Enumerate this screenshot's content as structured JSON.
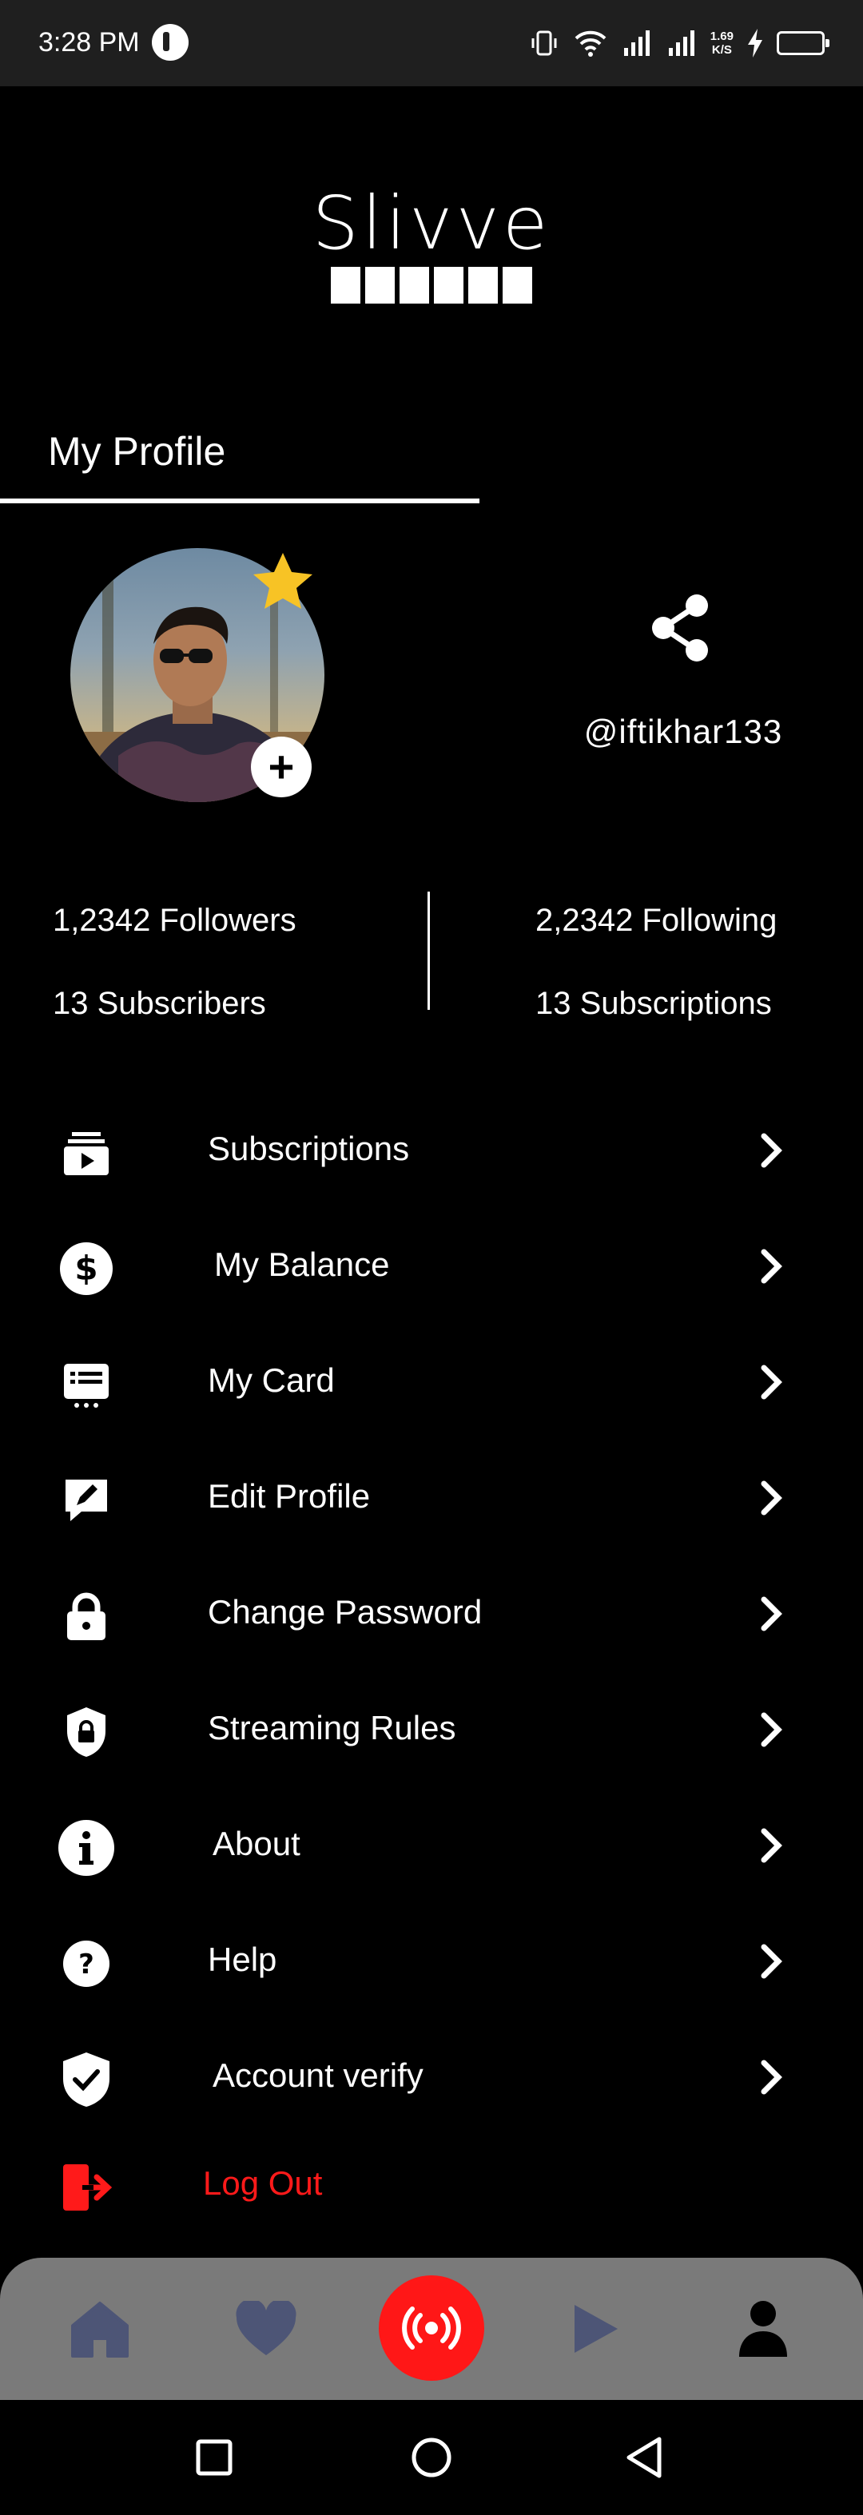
{
  "status_bar": {
    "time": "3:28 PM",
    "net_speed_value": "1.69",
    "net_speed_unit": "K/S"
  },
  "logo": {
    "text": "Slivve"
  },
  "tab": {
    "label": "My Profile"
  },
  "profile": {
    "username": "@iftikhar133"
  },
  "stats": {
    "followers": "1,2342 Followers",
    "following": "2,2342 Following",
    "subscribers": "13 Subscribers",
    "subscriptions": "13 Subscriptions"
  },
  "menu": {
    "items": [
      {
        "label": "Subscriptions",
        "icon": "subscriptions-icon"
      },
      {
        "label": "My Balance",
        "icon": "dollar-icon"
      },
      {
        "label": "My Card",
        "icon": "card-icon"
      },
      {
        "label": "Edit Profile",
        "icon": "edit-icon"
      },
      {
        "label": "Change Password",
        "icon": "lock-icon"
      },
      {
        "label": "Streaming Rules",
        "icon": "shield-lock-icon"
      },
      {
        "label": "About",
        "icon": "info-icon"
      },
      {
        "label": "Help",
        "icon": "help-icon"
      },
      {
        "label": "Account verify",
        "icon": "verified-shield-icon"
      }
    ],
    "logout_label": "Log Out"
  },
  "bottom_nav": {
    "items": [
      "home-icon",
      "heart-icon",
      "live-icon",
      "play-icon",
      "profile-icon"
    ],
    "active": "profile-icon"
  },
  "colors": {
    "accent": "#ff1717",
    "logout": "#ff1a1a",
    "star": "#f7c325",
    "nav_bg": "#7a7a7a",
    "nav_inactive": "#4d5576"
  }
}
